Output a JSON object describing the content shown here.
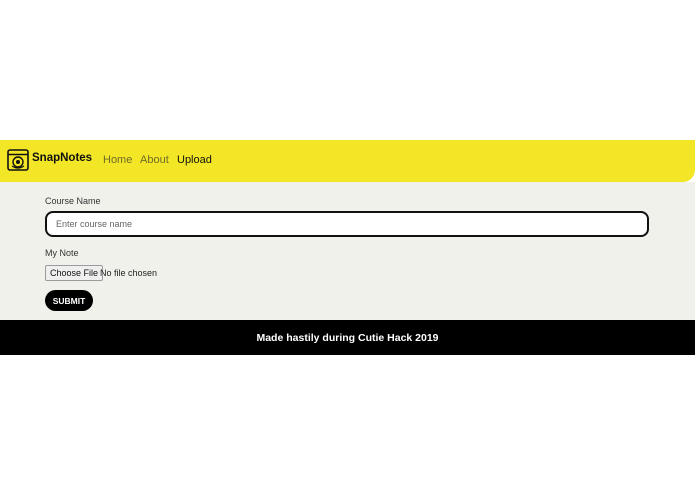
{
  "colors": {
    "navbar_bg": "#f2e626",
    "content_bg": "#f0f1eb",
    "footer_bg": "#000000",
    "accent_dark": "#000000"
  },
  "navbar": {
    "logo_icon": "camera-icon",
    "brand": "SnapNotes",
    "links": [
      {
        "label": "Home"
      },
      {
        "label": "About"
      },
      {
        "label": "Upload",
        "active": true
      }
    ]
  },
  "form": {
    "course_label": "Course Name",
    "course_placeholder": "Enter course name",
    "note_label": "My Note",
    "file_button_label": "Choose File",
    "file_status": "No file chosen",
    "submit_label": "SUBMIT"
  },
  "footer": {
    "text": "Made hastily during Cutie Hack 2019"
  }
}
